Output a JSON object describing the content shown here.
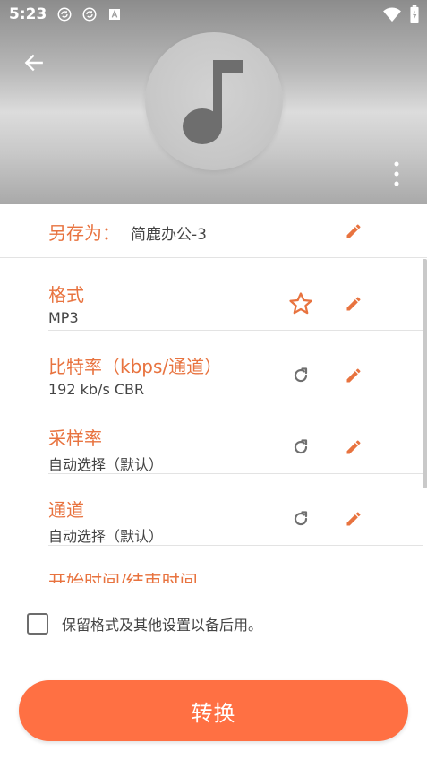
{
  "status_bar": {
    "time": "5:23",
    "icons": [
      "sync-icon",
      "sync-icon",
      "font-icon",
      "wifi-icon",
      "battery-icon"
    ]
  },
  "header": {
    "back_icon": "arrow-left-icon",
    "album_icon": "music-note-icon",
    "more_icon": "more-vertical-icon"
  },
  "save_as": {
    "label": "另存为：",
    "value": "简鹿办公-3",
    "edit_icon": "pencil-icon"
  },
  "settings": [
    {
      "title": "格式",
      "value": "MP3",
      "action_icon": "star-outline-icon",
      "edit_icon": "pencil-icon"
    },
    {
      "title": "比特率（kbps/通道）",
      "value": "192 kb/s CBR",
      "action_icon": "refresh-icon",
      "edit_icon": "pencil-icon"
    },
    {
      "title": "采样率",
      "value": "自动选择（默认）",
      "action_icon": "refresh-icon",
      "edit_icon": "pencil-icon"
    },
    {
      "title": "通道",
      "value": "自动选择（默认）",
      "action_icon": "refresh-icon",
      "edit_icon": "pencil-icon"
    },
    {
      "title": "开始时间/结束时间",
      "value": "",
      "action_icon": "refresh-icon",
      "edit_icon": "pencil-icon"
    }
  ],
  "keep_settings": {
    "label": "保留格式及其他设置以备后用。",
    "checked": false
  },
  "convert_button": {
    "label": "转换"
  },
  "colors": {
    "accent": "#e8733f",
    "button": "#ff7043",
    "icon_gray": "#6f6f6f"
  }
}
